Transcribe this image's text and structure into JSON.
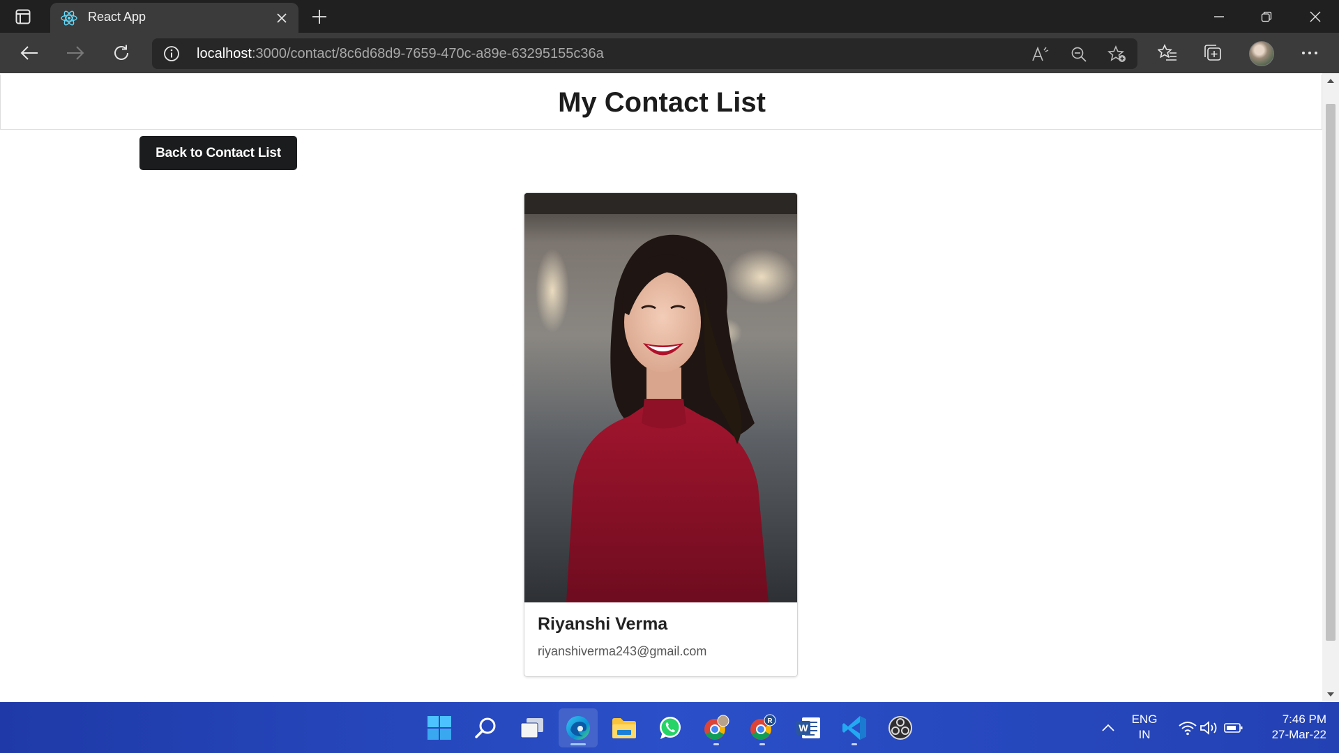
{
  "browser": {
    "tab_title": "React App",
    "url_host": "localhost",
    "url_path": ":3000/contact/8c6d68d9-7659-470c-a89e-63295155c36a"
  },
  "page": {
    "title": "My Contact List",
    "back_button": "Back to Contact List"
  },
  "contact": {
    "name": "Riyanshi Verma",
    "email": "riyanshiverma243@gmail.com"
  },
  "taskbar": {
    "apps": [
      "start-icon",
      "search-icon",
      "task-view-icon",
      "edge-icon",
      "file-explorer-icon",
      "whatsapp-icon",
      "chrome-profile-icon",
      "chrome-r-icon",
      "word-icon",
      "vscode-icon",
      "obs-icon"
    ],
    "language_line1": "ENG",
    "language_line2": "IN",
    "time": "7:46 PM",
    "date": "27-Mar-22"
  },
  "colors": {
    "chrome_dark": "#202020",
    "toolbar": "#3b3b3b",
    "button_dark": "#1b1c1d",
    "taskbar_blue": "#2a4fc8"
  }
}
